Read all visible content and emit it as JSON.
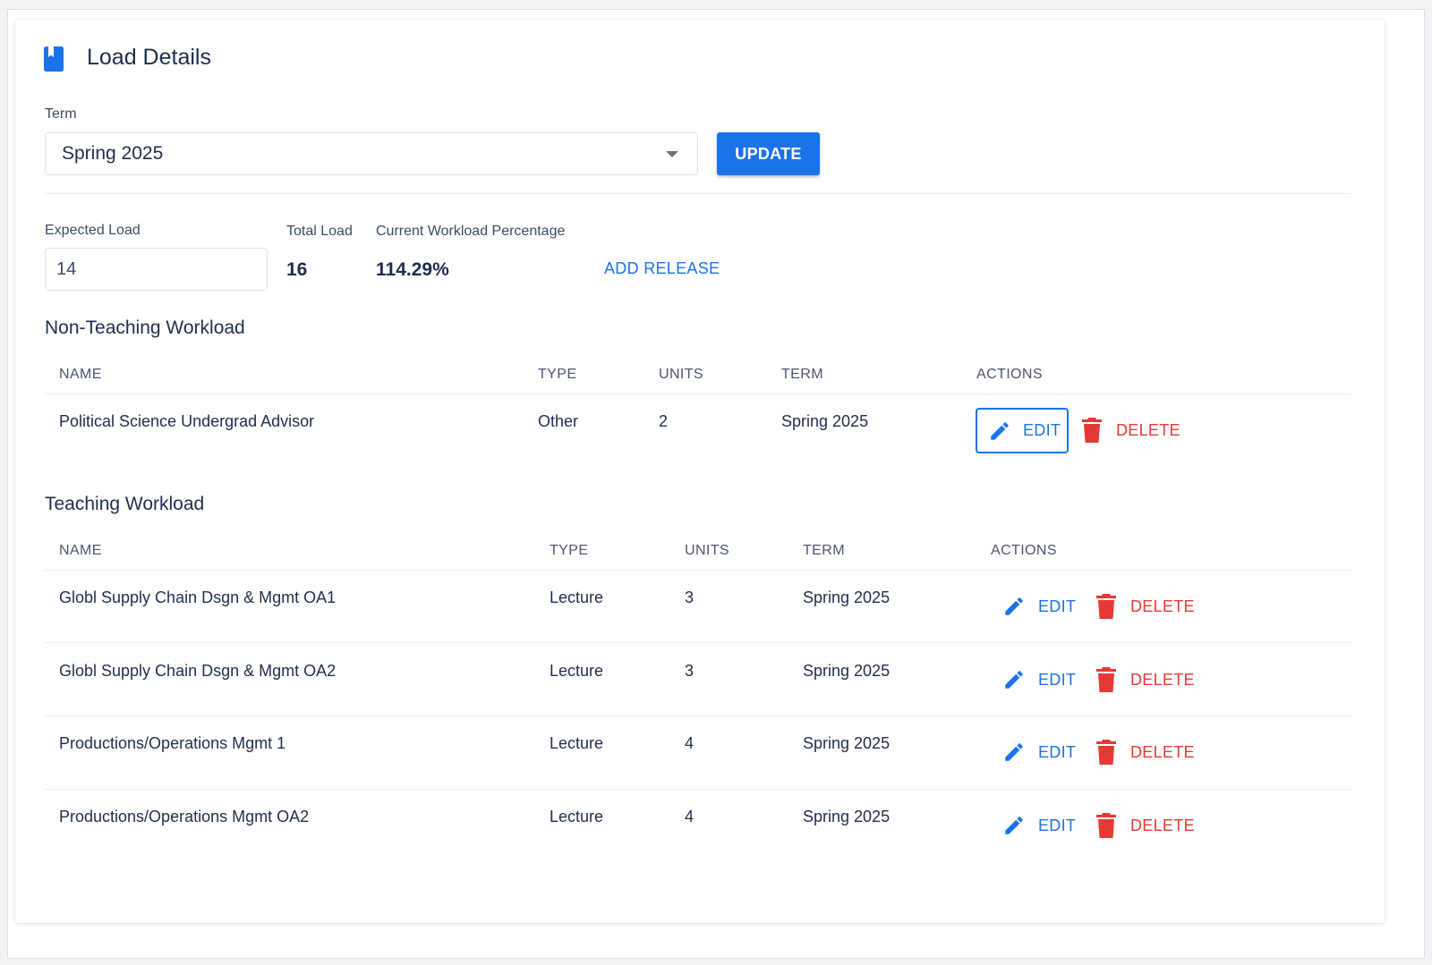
{
  "page": {
    "title": "Load Details"
  },
  "term": {
    "label": "Term",
    "selected": "Spring 2025"
  },
  "update_label": "UPDATE",
  "load": {
    "expected_label": "Expected Load",
    "expected_value": "14",
    "total_label": "Total Load",
    "total_value": "16",
    "pct_label": "Current Workload Percentage",
    "pct_value": "114.29%",
    "add_release": "ADD RELEASE"
  },
  "non_teaching": {
    "title": "Non-Teaching Workload",
    "headers": {
      "name": "NAME",
      "type": "TYPE",
      "units": "UNITS",
      "term": "TERM",
      "actions": "ACTIONS"
    },
    "rows": [
      {
        "name": "Political Science Undergrad Advisor",
        "type": "Other",
        "units": "2",
        "term": "Spring 2025"
      }
    ]
  },
  "teaching": {
    "title": "Teaching Workload",
    "headers": {
      "name": "NAME",
      "type": "TYPE",
      "units": "UNITS",
      "term": "TERM",
      "actions": "ACTIONS"
    },
    "rows": [
      {
        "name": "Globl Supply Chain Dsgn & Mgmt OA1",
        "type": "Lecture",
        "units": "3",
        "term": "Spring 2025"
      },
      {
        "name": "Globl Supply Chain Dsgn & Mgmt OA2",
        "type": "Lecture",
        "units": "3",
        "term": "Spring 2025"
      },
      {
        "name": "Productions/Operations Mgmt 1",
        "type": "Lecture",
        "units": "4",
        "term": "Spring 2025"
      },
      {
        "name": "Productions/Operations Mgmt OA2",
        "type": "Lecture",
        "units": "4",
        "term": "Spring 2025"
      }
    ]
  },
  "actions": {
    "edit": "EDIT",
    "delete": "DELETE"
  },
  "icons": {
    "title": "book-icon",
    "edit": "pencil-icon",
    "delete": "trash-icon",
    "dropdown": "caret-down-icon"
  },
  "colors": {
    "primary": "#1a73e8",
    "danger": "#e53935",
    "text": "#1f2d4d"
  }
}
